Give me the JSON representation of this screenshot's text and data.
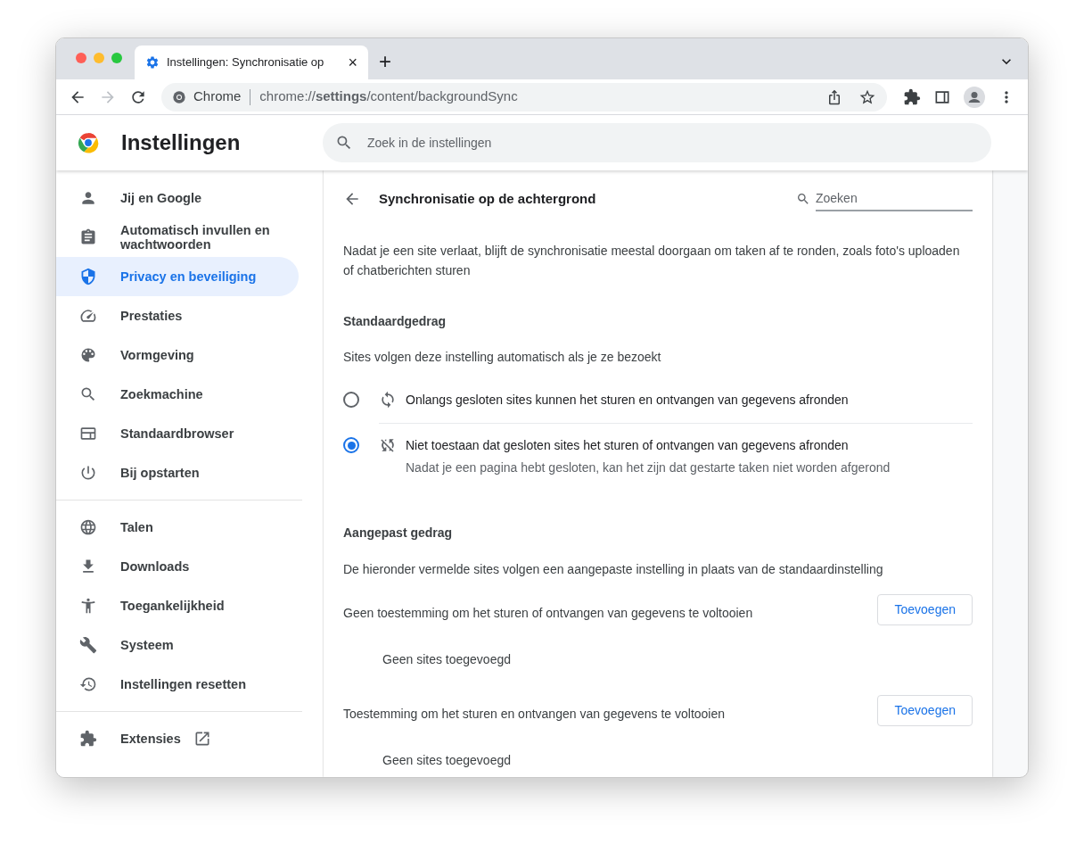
{
  "tab": {
    "title": "Instellingen: Synchronisatie op",
    "close": "×"
  },
  "new_tab": "+",
  "address_bar": {
    "site_label": "Chrome",
    "url": "chrome://**settings**/content/backgroundSync"
  },
  "header": {
    "title": "Instellingen",
    "search_placeholder": "Zoek in de instellingen"
  },
  "sidebar": {
    "sections": [
      {
        "items": [
          {
            "label": "Jij en Google",
            "selected": false
          },
          {
            "label": "Automatisch invullen en wachtwoorden",
            "selected": false
          },
          {
            "label": "Privacy en beveiliging",
            "selected": true
          },
          {
            "label": "Prestaties",
            "selected": false
          },
          {
            "label": "Vormgeving",
            "selected": false
          },
          {
            "label": "Zoekmachine",
            "selected": false
          },
          {
            "label": "Standaardbrowser",
            "selected": false
          },
          {
            "label": "Bij opstarten",
            "selected": false
          }
        ]
      },
      {
        "items": [
          {
            "label": "Talen",
            "selected": false
          },
          {
            "label": "Downloads",
            "selected": false
          },
          {
            "label": "Toegankelijkheid",
            "selected": false
          },
          {
            "label": "Systeem",
            "selected": false
          },
          {
            "label": "Instellingen resetten",
            "selected": false
          }
        ]
      },
      {
        "items": [
          {
            "label": "Extensies",
            "selected": false
          }
        ]
      }
    ]
  },
  "page": {
    "title": "Synchronisatie op de achtergrond",
    "search_placeholder": "Zoeken",
    "description": "Nadat je een site verlaat, blijft de synchronisatie meestal doorgaan om taken af te ronden, zoals foto's uploaden of chatberichten sturen",
    "default_behavior": {
      "heading": "Standaardgedrag",
      "subheading": "Sites volgen deze instelling automatisch als je ze bezoekt",
      "options": [
        {
          "label": "Onlangs gesloten sites kunnen het sturen en ontvangen van gegevens afronden",
          "selected": false
        },
        {
          "label": "Niet toestaan dat gesloten sites het sturen of ontvangen van gegevens afronden",
          "description": "Nadat je een pagina hebt gesloten, kan het zijn dat gestarte taken niet worden afgerond",
          "selected": true
        }
      ]
    },
    "custom_behavior": {
      "heading": "Aangepast gedrag",
      "subheading": "De hieronder vermelde sites volgen een aangepaste instelling in plaats van de standaardinstelling",
      "lists": [
        {
          "label": "Geen toestemming om het sturen of ontvangen van gegevens te voltooien",
          "button": "Toevoegen",
          "empty": "Geen sites toegevoegd"
        },
        {
          "label": "Toestemming om het sturen en ontvangen van gegevens te voltooien",
          "button": "Toevoegen",
          "empty": "Geen sites toegevoegd"
        }
      ]
    }
  }
}
